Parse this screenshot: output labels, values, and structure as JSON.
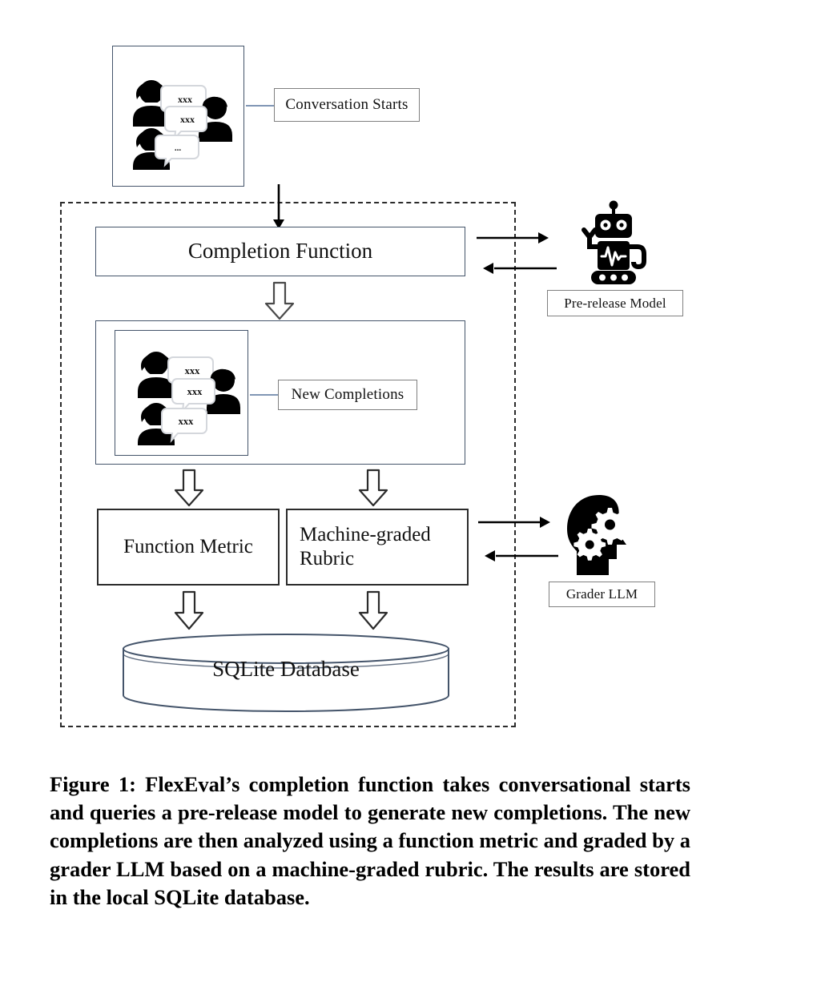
{
  "figure": {
    "conversation_box": {
      "name": "Conversation Starts box",
      "bubbles": [
        "xxx",
        "xxx",
        "..."
      ],
      "callout_label": "Conversation Starts"
    },
    "completion_function": {
      "label": "Completion Function"
    },
    "pre_release_model": {
      "icon": "robot-icon",
      "callout_label": "Pre-release Model"
    },
    "new_completions_box": {
      "bubbles": [
        "xxx",
        "xxx",
        "xxx"
      ],
      "callout_label": "New Completions"
    },
    "function_metric": {
      "label": "Function Metric"
    },
    "machine_graded_rubric": {
      "label": "Machine-graded Rubric"
    },
    "grader_llm": {
      "icon": "head-with-gears-icon",
      "callout_label": "Grader LLM"
    },
    "database": {
      "label": "SQLite Database"
    },
    "colors": {
      "box_border_blue": "#44546a",
      "box_border_dark": "#2b2b2b",
      "callout_border_gray": "#808080",
      "connector_blue": "#8096b4",
      "icon_black": "#000000"
    }
  },
  "caption": {
    "text": "Figure 1: FlexEval’s completion function takes conversational starts and queries a pre-release model to generate new completions. The new completions are then analyzed using a function metric and graded by a grader LLM based on a machine-graded rubric. The results are stored in the local SQLite database."
  }
}
